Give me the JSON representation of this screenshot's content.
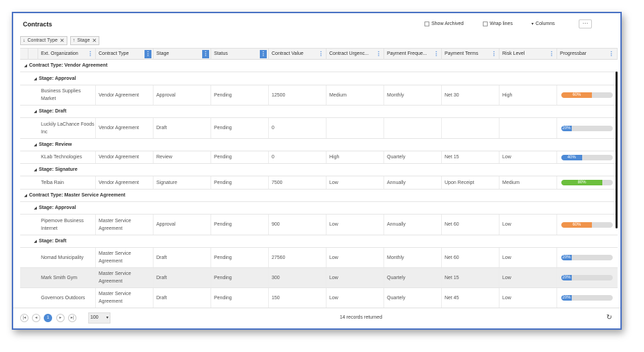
{
  "title": "Contracts",
  "toolbar": {
    "show_archived": "Show Archived",
    "wrap_lines": "Wrap lines",
    "columns": "Columns",
    "more": "···"
  },
  "grouping": {
    "chips": [
      {
        "arrow": "↓",
        "label": "Contract Type"
      },
      {
        "arrow": "↑",
        "label": "Stage"
      }
    ]
  },
  "columns": [
    "Ext. Organization",
    "Contract Type",
    "Stage",
    "Status",
    "Contract Value",
    "Contract Urgenc...",
    "Payment Freque...",
    "Payment Terms",
    "Risk Level",
    "Progressbar"
  ],
  "groups": [
    {
      "label": "Contract Type: Vendor Agreement"
    },
    {
      "label": "Stage: Approval"
    },
    {
      "label": "Stage: Draft"
    },
    {
      "label": "Stage: Review"
    },
    {
      "label": "Stage: Signature"
    },
    {
      "label": "Contract Type: Master Service Agreement"
    },
    {
      "label": "Stage: Approval"
    },
    {
      "label": "Stage: Draft"
    }
  ],
  "rows": [
    {
      "org": "Business Supplies Market",
      "type": "Vendor Agreement",
      "stage": "Approval",
      "status": "Pending",
      "value": "12500",
      "urgency": "Medium",
      "freq": "Monthly",
      "terms": "Net 30",
      "risk": "High",
      "progress": "60%",
      "progress_value": 0.6,
      "color": "#f0934a"
    },
    {
      "org": "Luckily LaChance Foods Inc",
      "type": "Vendor Agreement",
      "stage": "Draft",
      "status": "Pending",
      "value": "0",
      "urgency": "",
      "freq": "",
      "terms": "",
      "risk": "",
      "progress": "20%",
      "progress_value": 0.2,
      "color": "#4d8ad6"
    },
    {
      "org": "KLab Technologies",
      "type": "Vendor Agreement",
      "stage": "Review",
      "status": "Pending",
      "value": "0",
      "urgency": "High",
      "freq": "Quartely",
      "terms": "Net 15",
      "risk": "Low",
      "progress": "40%",
      "progress_value": 0.4,
      "color": "#4d8ad6"
    },
    {
      "org": "Telba Rain",
      "type": "Vendor Agreement",
      "stage": "Signature",
      "status": "Pending",
      "value": "7500",
      "urgency": "Low",
      "freq": "Annually",
      "terms": "Upon Receipt",
      "risk": "Medium",
      "progress": "80%",
      "progress_value": 0.8,
      "color": "#6cbf3d"
    },
    {
      "org": "Pipemove Business Internet",
      "type": "Master Service Agreement",
      "stage": "Approval",
      "status": "Pending",
      "value": "900",
      "urgency": "Low",
      "freq": "Annually",
      "terms": "Net 60",
      "risk": "Low",
      "progress": "60%",
      "progress_value": 0.6,
      "color": "#f0934a"
    },
    {
      "org": "Nomad Municipality",
      "type": "Master Service Agreement",
      "stage": "Draft",
      "status": "Pending",
      "value": "27560",
      "urgency": "Low",
      "freq": "Monthly",
      "terms": "Net 60",
      "risk": "Low",
      "progress": "20%",
      "progress_value": 0.2,
      "color": "#4d8ad6"
    },
    {
      "org": "Mark Smith Gym",
      "type": "Master Service Agreement",
      "stage": "Draft",
      "status": "Pending",
      "value": "300",
      "urgency": "Low",
      "freq": "Quartely",
      "terms": "Net 15",
      "risk": "Low",
      "progress": "20%",
      "progress_value": 0.2,
      "color": "#4d8ad6"
    },
    {
      "org": "Governors Outdoors",
      "type": "Master Service Agreement",
      "stage": "Draft",
      "status": "Pending",
      "value": "150",
      "urgency": "Low",
      "freq": "Quartely",
      "terms": "Net 45",
      "risk": "Low",
      "progress": "20%",
      "progress_value": 0.2,
      "color": "#4d8ad6"
    }
  ],
  "footer": {
    "first": "|◂",
    "prev": "◂",
    "page": "1",
    "next": "▸",
    "last": "▸|",
    "page_size": "100",
    "page_size_caret": "▾",
    "records": "14 records returned",
    "refresh": "↻"
  }
}
